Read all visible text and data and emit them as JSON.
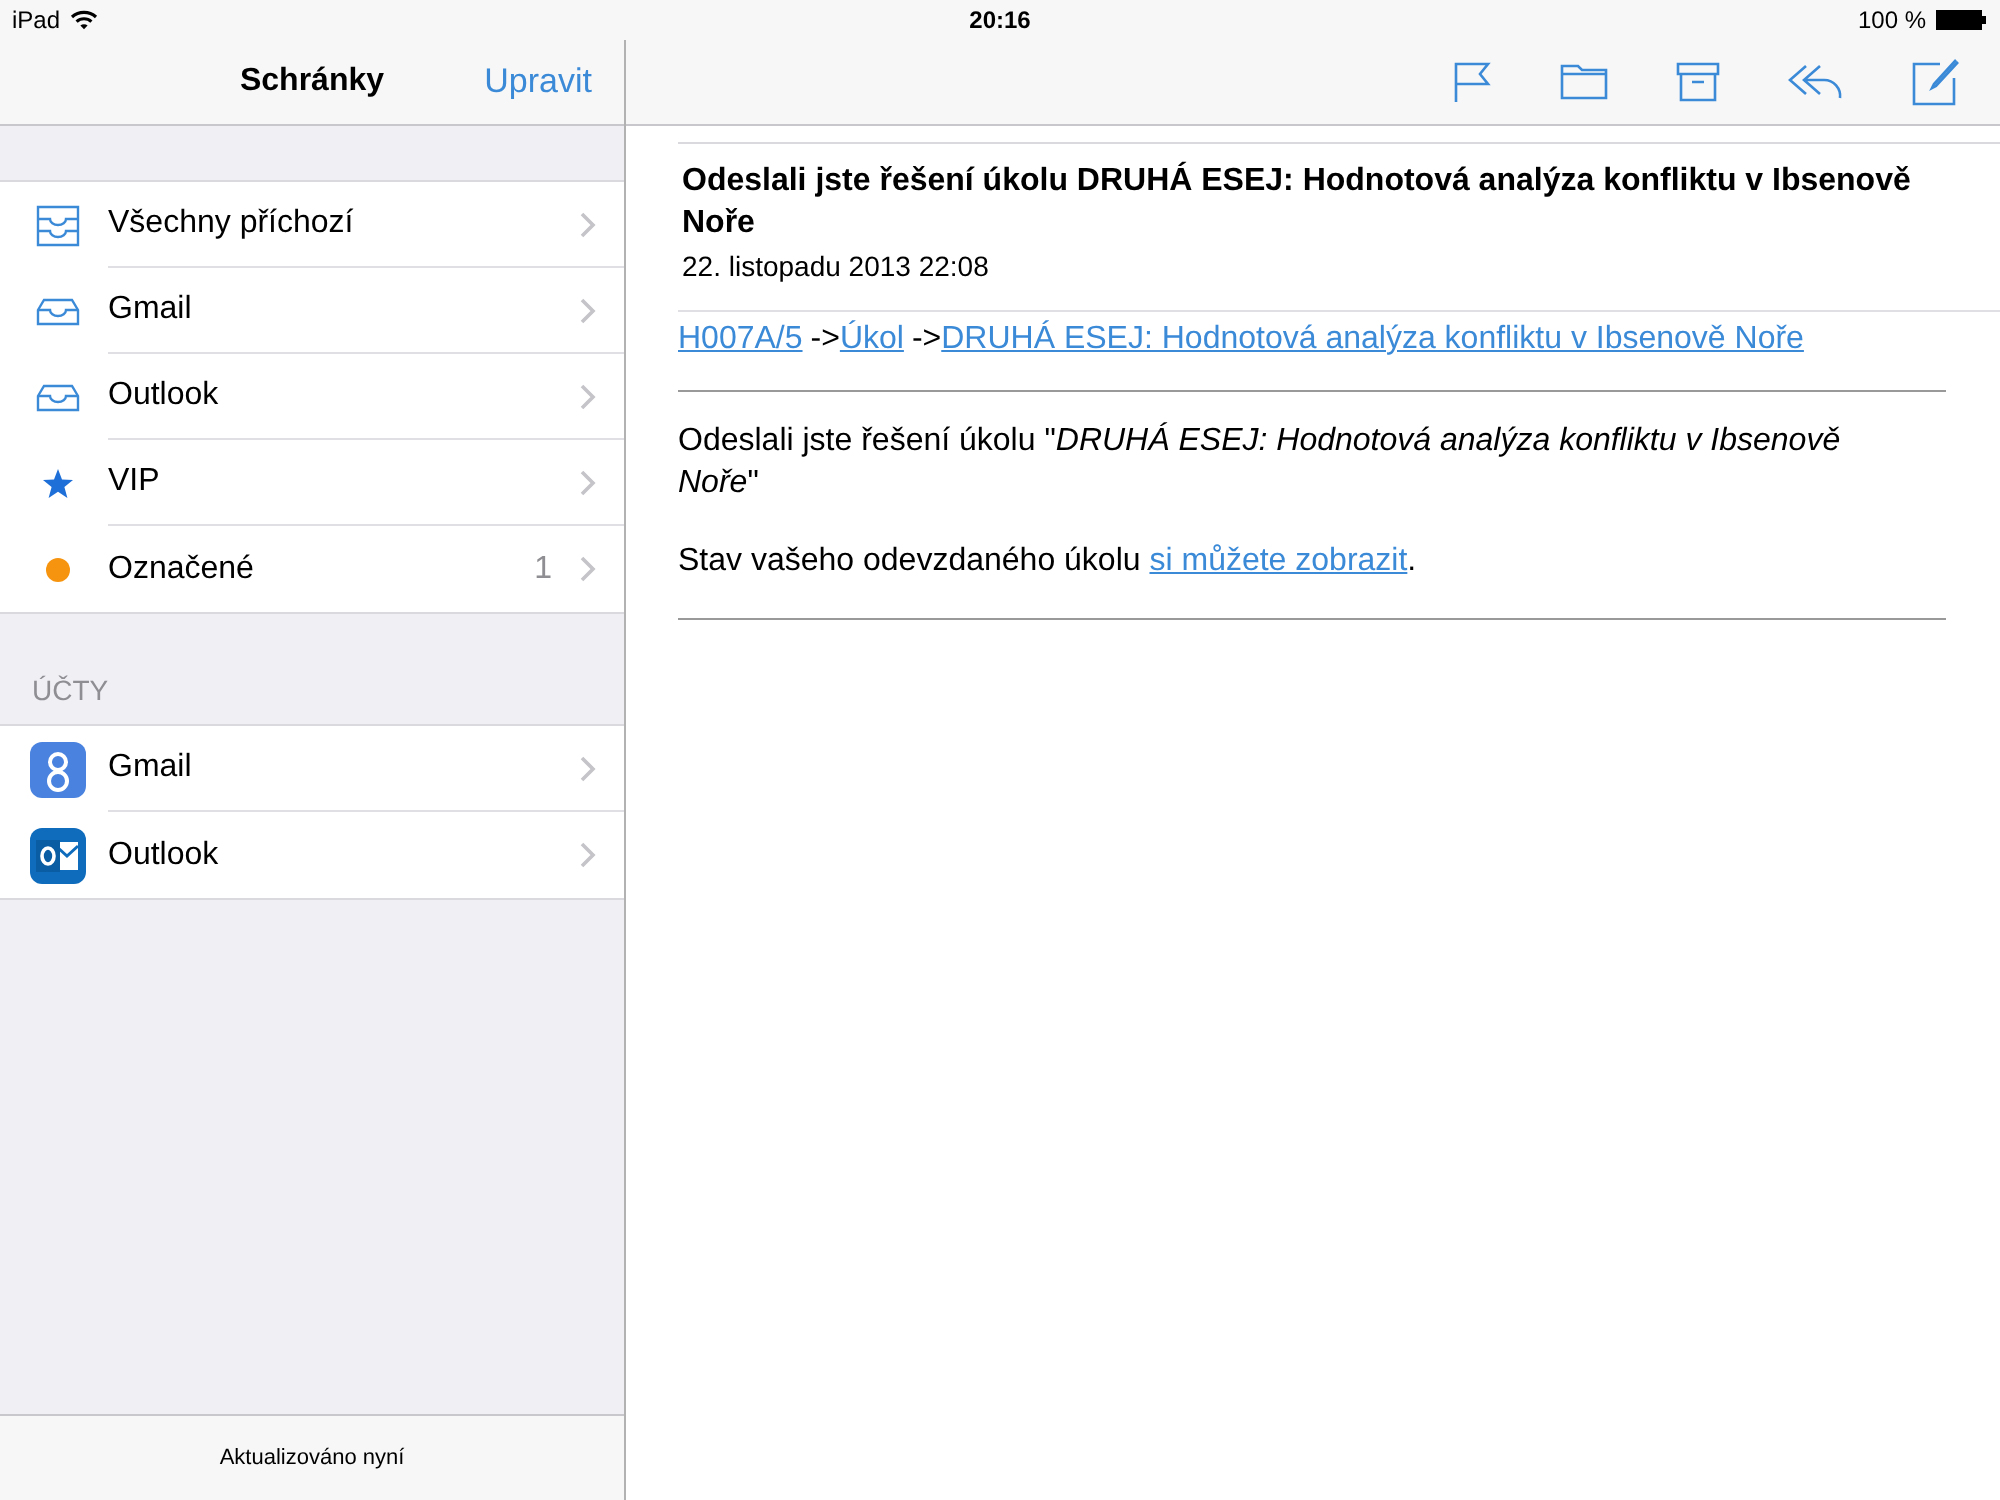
{
  "status_bar": {
    "device": "iPad",
    "time": "20:16",
    "battery": "100 %"
  },
  "sidebar": {
    "title": "Schránky",
    "edit_button": "Upravit",
    "mailboxes": [
      {
        "label": "Všechny příchozí"
      },
      {
        "label": "Gmail"
      },
      {
        "label": "Outlook"
      },
      {
        "label": "VIP"
      },
      {
        "label": "Označené",
        "count": "1",
        "color": "#f7940f"
      }
    ],
    "accounts_header": "ÚČTY",
    "accounts": [
      {
        "label": "Gmail"
      },
      {
        "label": "Outlook"
      }
    ],
    "footer": "Aktualizováno nyní"
  },
  "message": {
    "subject": "Odeslali jste řešení úkolu DRUHÁ ESEJ: Hodnotová analýza konfliktu v Ibsenově Noře",
    "date": "22. listopadu 2013 22:08",
    "breadcrumb": [
      {
        "kind": "link",
        "text": "H007A/5"
      },
      {
        "kind": "text",
        "text": "->"
      },
      {
        "kind": "link",
        "text": "Úkol"
      },
      {
        "kind": "text",
        "text": "->"
      },
      {
        "kind": "link",
        "text": "DRUHÁ ESEJ: Hodnotová analýza konfliktu v Ibsenově Noře"
      }
    ],
    "paragraph": "Odeslali jste řešení úkolu \"*DRUHÁ ESEJ: Hodnotová analýza konfliktu v Ibsenově Noře*\"",
    "status_line": [
      {
        "kind": "text",
        "text": "Stav vašeho odevzdaného úkolu "
      },
      {
        "kind": "link",
        "text": "si můžete zobrazit"
      },
      {
        "kind": "text",
        "text": "."
      }
    ]
  }
}
